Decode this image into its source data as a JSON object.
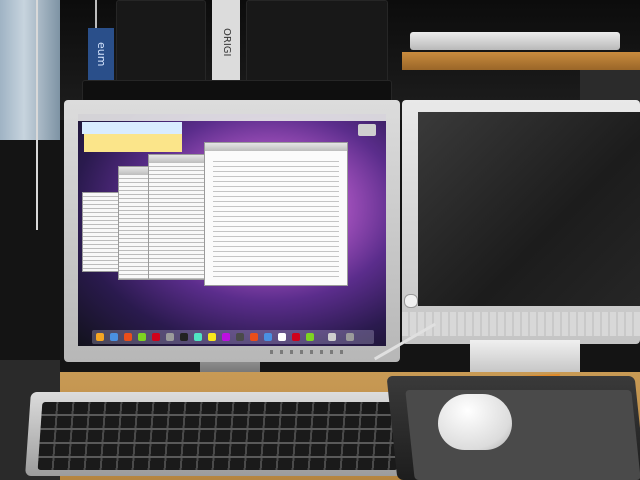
{
  "scene": {
    "description_label": "",
    "shelf": {
      "binder_label": "eum",
      "book_label": "ORIGI"
    },
    "main_monitor": {
      "desktop": {
        "stickies": 2,
        "windows": 3,
        "dock_icons": 18
      }
    },
    "colors": {
      "desk": "#c89a55",
      "wallpaper_center": "#f0a0e6",
      "wallpaper_edge": "#2a1a4e",
      "bezel": "#d0d0d0"
    }
  }
}
